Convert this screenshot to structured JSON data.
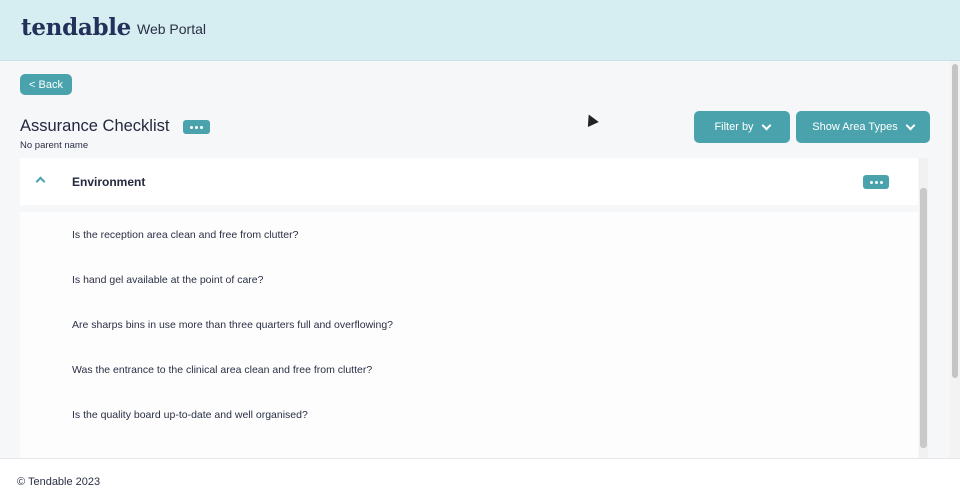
{
  "header": {
    "logo": "tendable",
    "portal_title": "Web Portal"
  },
  "toolbar": {
    "back_label": "< Back",
    "filter_label": "Filter by",
    "area_types_label": "Show Area Types"
  },
  "page": {
    "title": "Assurance Checklist",
    "parent_name": "No parent name"
  },
  "section": {
    "title": "Environment",
    "questions": [
      "Is the reception area clean and free from clutter?",
      "Is hand gel available at the point of care?",
      "Are sharps bins in use more than three quarters full and overflowing?",
      "Was the entrance to the clinical area clean and free from clutter?",
      "Is the quality board up-to-date and well organised?"
    ]
  },
  "footer": {
    "copyright": "© Tendable 2023"
  },
  "colors": {
    "accent": "#4aa3ac",
    "header_bg": "#d6eef1",
    "text": "#2a2f45"
  }
}
